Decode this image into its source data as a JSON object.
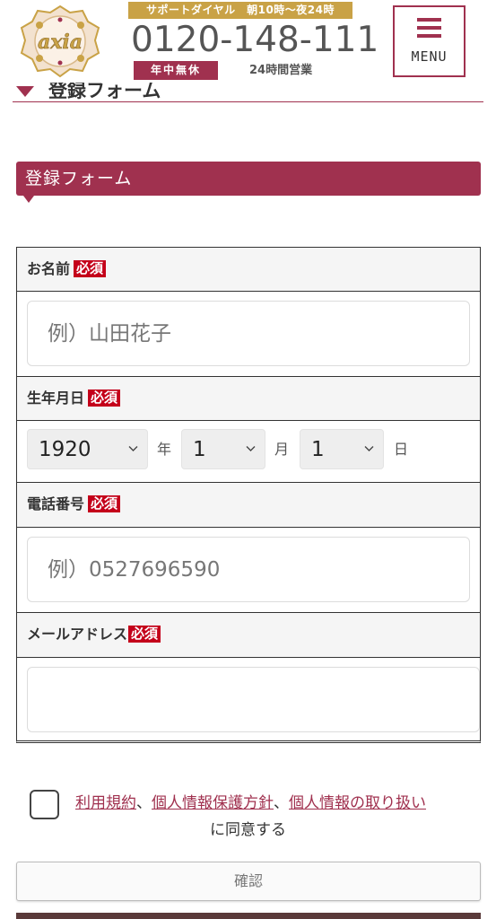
{
  "header": {
    "logo_text": "axia",
    "support_label": "サポートダイヤル　朝10時〜夜24時",
    "phone": "0120-148-111",
    "holiday_badge": "年中無休",
    "hours": "24時間営業",
    "menu_label": "MENU"
  },
  "prev_section": {
    "heading": "登録フォーム"
  },
  "form": {
    "heading": "登録フォーム",
    "required_badge": "必須",
    "name": {
      "label": "お名前",
      "placeholder": "例）山田花子"
    },
    "birthday": {
      "label": "生年月日",
      "year": "1920",
      "month": "1",
      "day": "1",
      "year_unit": "年",
      "month_unit": "月",
      "day_unit": "日"
    },
    "phone": {
      "label": "電話番号",
      "placeholder": "例）0527696590"
    },
    "email": {
      "label": "メールアドレス",
      "placeholder": ""
    }
  },
  "agreement": {
    "terms_link": "利用規約",
    "sep1": "、",
    "privacy_link": "個人情報保護方針",
    "sep2": "、",
    "handling_link": "個人情報の取り扱い",
    "suffix": "に同意する"
  },
  "confirm_button": "確認",
  "colors": {
    "brand": "#a0314f",
    "gold": "#c9a246",
    "required": "#c4001a"
  }
}
